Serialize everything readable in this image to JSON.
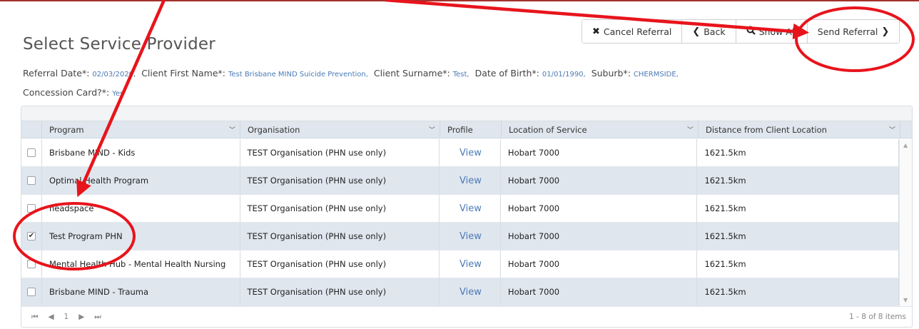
{
  "title": "Select Service Provider",
  "toolbar": {
    "cancel_label": "Cancel Referral",
    "back_label": "Back",
    "show_all_label": "Show All",
    "send_label": "Send Referral"
  },
  "referral": {
    "date_label": "Referral Date*:",
    "date_value": "02/03/2020,",
    "first_name_label": "Client First Name*:",
    "first_name_value": "Test Brisbane MIND Suicide Prevention,",
    "surname_label": "Client Surname*:",
    "surname_value": "Test,",
    "dob_label": "Date of Birth*:",
    "dob_value": "01/01/1990,",
    "suburb_label": "Suburb*:",
    "suburb_value": "CHERMSIDE,",
    "concession_label": "Concession Card?*:",
    "concession_value": "Yes"
  },
  "grid": {
    "columns": [
      "Program",
      "Organisation",
      "Profile",
      "Location of Service",
      "Distance from Client Location"
    ],
    "rows": [
      {
        "program": "Brisbane MIND - Kids",
        "organisation": "TEST Organisation (PHN use only)",
        "profile": "View",
        "location": "Hobart 7000",
        "distance": "1621.5km",
        "checked": false
      },
      {
        "program": "Optimal Health Program",
        "organisation": "TEST Organisation (PHN use only)",
        "profile": "View",
        "location": "Hobart 7000",
        "distance": "1621.5km",
        "checked": false
      },
      {
        "program": "headspace",
        "organisation": "TEST Organisation (PHN use only)",
        "profile": "View",
        "location": "Hobart 7000",
        "distance": "1621.5km",
        "checked": false
      },
      {
        "program": "Test Program PHN",
        "organisation": "TEST Organisation (PHN use only)",
        "profile": "View",
        "location": "Hobart 7000",
        "distance": "1621.5km",
        "checked": true
      },
      {
        "program": "Mental Health Hub - Mental Health Nursing",
        "organisation": "TEST Organisation (PHN use only)",
        "profile": "View",
        "location": "Hobart 7000",
        "distance": "1621.5km",
        "checked": false
      },
      {
        "program": "Brisbane MIND - Trauma",
        "organisation": "TEST Organisation (PHN use only)",
        "profile": "View",
        "location": "Hobart 7000",
        "distance": "1621.5km",
        "checked": false
      }
    ]
  },
  "pager": {
    "first": "⏮",
    "prev": "◀",
    "page": "1",
    "next": "▶",
    "last": "⏭",
    "info": "1 - 8 of 8 items"
  },
  "colors": {
    "annotation": "#e8141c",
    "link": "#4a7bb5",
    "alt_row": "#dfe6ee"
  },
  "icons": {
    "cancel": "x-icon",
    "back": "chevron-left-icon",
    "show_all": "search-icon",
    "send": "chevron-right-icon"
  }
}
